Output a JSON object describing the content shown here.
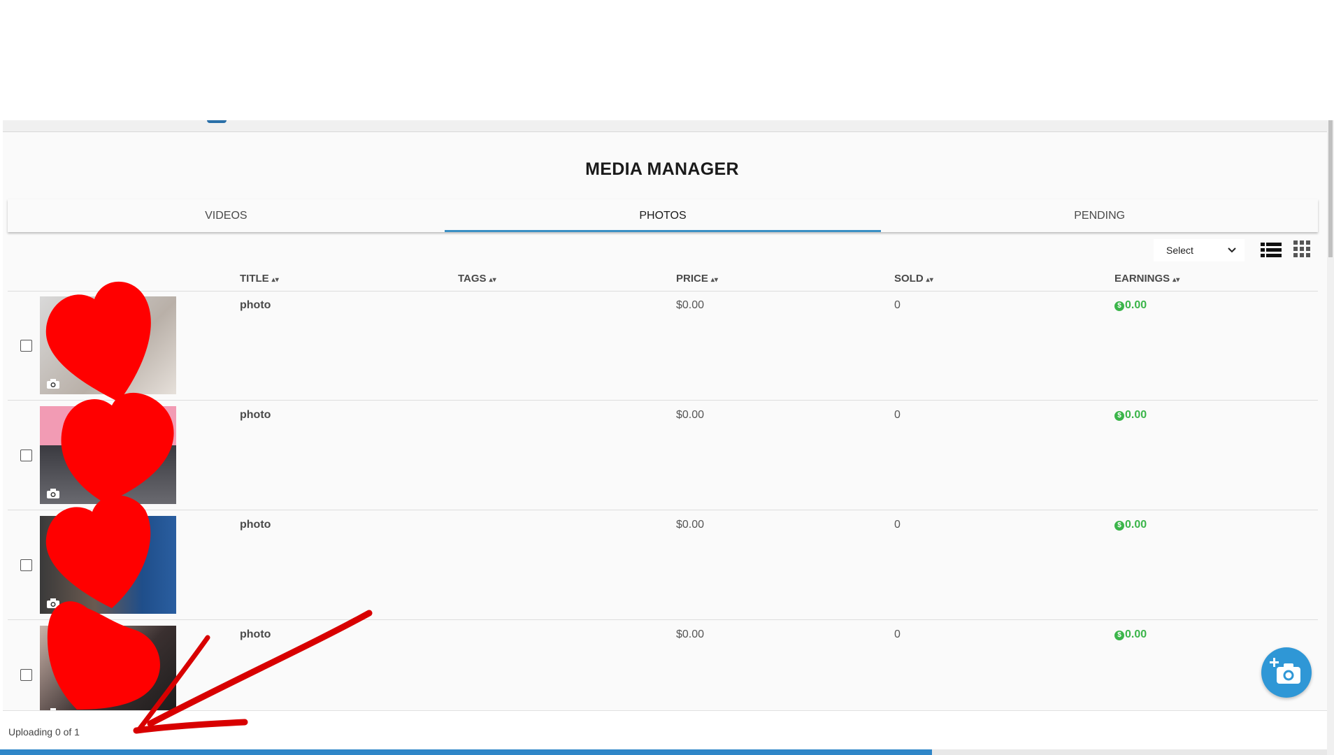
{
  "page": {
    "title": "MEDIA MANAGER"
  },
  "tabs": [
    {
      "label": "VIDEOS",
      "active": false
    },
    {
      "label": "PHOTOS",
      "active": true
    },
    {
      "label": "PENDING",
      "active": false
    }
  ],
  "toolbar": {
    "select_label": "Select",
    "list_view_icon": "list-view-icon",
    "grid_view_icon": "grid-view-icon"
  },
  "columns": {
    "title": "TITLE",
    "tags": "TAGS",
    "price": "PRICE",
    "sold": "SOLD",
    "earnings": "EARNINGS"
  },
  "rows": [
    {
      "title": "photo",
      "tags": "",
      "price": "$0.00",
      "sold": "0",
      "earnings": "0.00"
    },
    {
      "title": "photo",
      "tags": "",
      "price": "$0.00",
      "sold": "0",
      "earnings": "0.00"
    },
    {
      "title": "photo",
      "tags": "",
      "price": "$0.00",
      "sold": "0",
      "earnings": "0.00"
    },
    {
      "title": "photo",
      "tags": "",
      "price": "$0.00",
      "sold": "0",
      "earnings": "0.00"
    }
  ],
  "upload": {
    "status": "Uploading 0 of 1",
    "progress": 0.7
  },
  "colors": {
    "accent": "#2f97d6",
    "earnings": "#3bb54a",
    "annotation": "#e00000"
  }
}
